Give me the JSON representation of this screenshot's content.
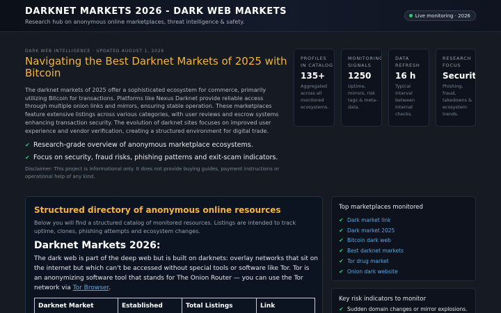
{
  "header": {
    "title": "DARKNET MARKETS 2026 - DARK WEB MARKETS",
    "tagline": "Research hub on anonymous online marketplaces, threat intelligence & safety.",
    "live_label": "Live monitoring · 2026"
  },
  "hero": {
    "meta": "DARK WEB INTELLIGENCE · UPDATED AUGUST 1, 2026",
    "title": "Navigating the Best Darknet Markets of 2025 with Bitcoin",
    "body": "The darknet markets of 2025 offer a sophisticated ecosystem for commerce, primarily utilizing Bitcoin for transactions. Platforms like Nexus Darknet provide reliable access through multiple onion links and mirrors, ensuring stable operation. These marketplaces feature extensive listings across various categories, with user reviews and escrow systems enhancing transaction security. The evolution of darknet sites focuses on improved user experience and vendor verification, creating a structured environment for digital trade.",
    "bullets": [
      "Research-grade overview of anonymous marketplace ecosystems.",
      "Focus on security, fraud risks, phishing patterns and exit-scam indicators."
    ],
    "disclaimer": "Disclaimer: This project is informational only. It does not provide buying guides, payment instructions or operational help of any kind."
  },
  "stats": [
    {
      "label": "PROFILES IN CATALOG",
      "value": "135+",
      "desc": "Aggregated across all monitored ecosystems."
    },
    {
      "label": "MONITORING SIGNALS",
      "value": "1250",
      "desc": "Uptime, mirrors, risk tags & meta-data."
    },
    {
      "label": "DATA REFRESH",
      "value": "16 h",
      "desc": "Typical interval between internal checks."
    },
    {
      "label": "RESEARCH FOCUS",
      "value": "Security",
      "desc": "Phishing, fraud, takedowns & ecosystem trends."
    }
  ],
  "directory": {
    "heading": "Structured directory of anonymous online resources",
    "intro": "Below you will find a structured catalog of monitored resources. Listings are intended to track uptime, clones, phishing attempts and ecosystem changes.",
    "subhead": "Darknet Markets 2026:",
    "body_text": "The dark web is part of the deep web but is built on darknets: overlay networks that sit on the internet but which can't be accessed without special tools or software like Tor. Tor is an anonymizing software tool that stands for The Onion Router — you can use the Tor network via ",
    "body_link": "Tor Browser",
    "body_end": ".",
    "table_headers": [
      "Darknet Market",
      "Established",
      "Total Listings",
      "Link"
    ]
  },
  "top_markets": {
    "heading": "Top marketplaces monitored",
    "items": [
      "Dark market link",
      "Dark market 2025",
      "Bitcoin dark web",
      "Best darknet markets",
      "Tor drug market",
      "Onion dark website"
    ]
  },
  "risk": {
    "heading": "Key risk indicators to monitor",
    "items": [
      "Sudden domain changes or mirror explosions."
    ]
  },
  "colors": {
    "accent": "#f4b53f",
    "link": "#5aa9e6",
    "check": "#2ecc71",
    "background": "#161a22"
  }
}
